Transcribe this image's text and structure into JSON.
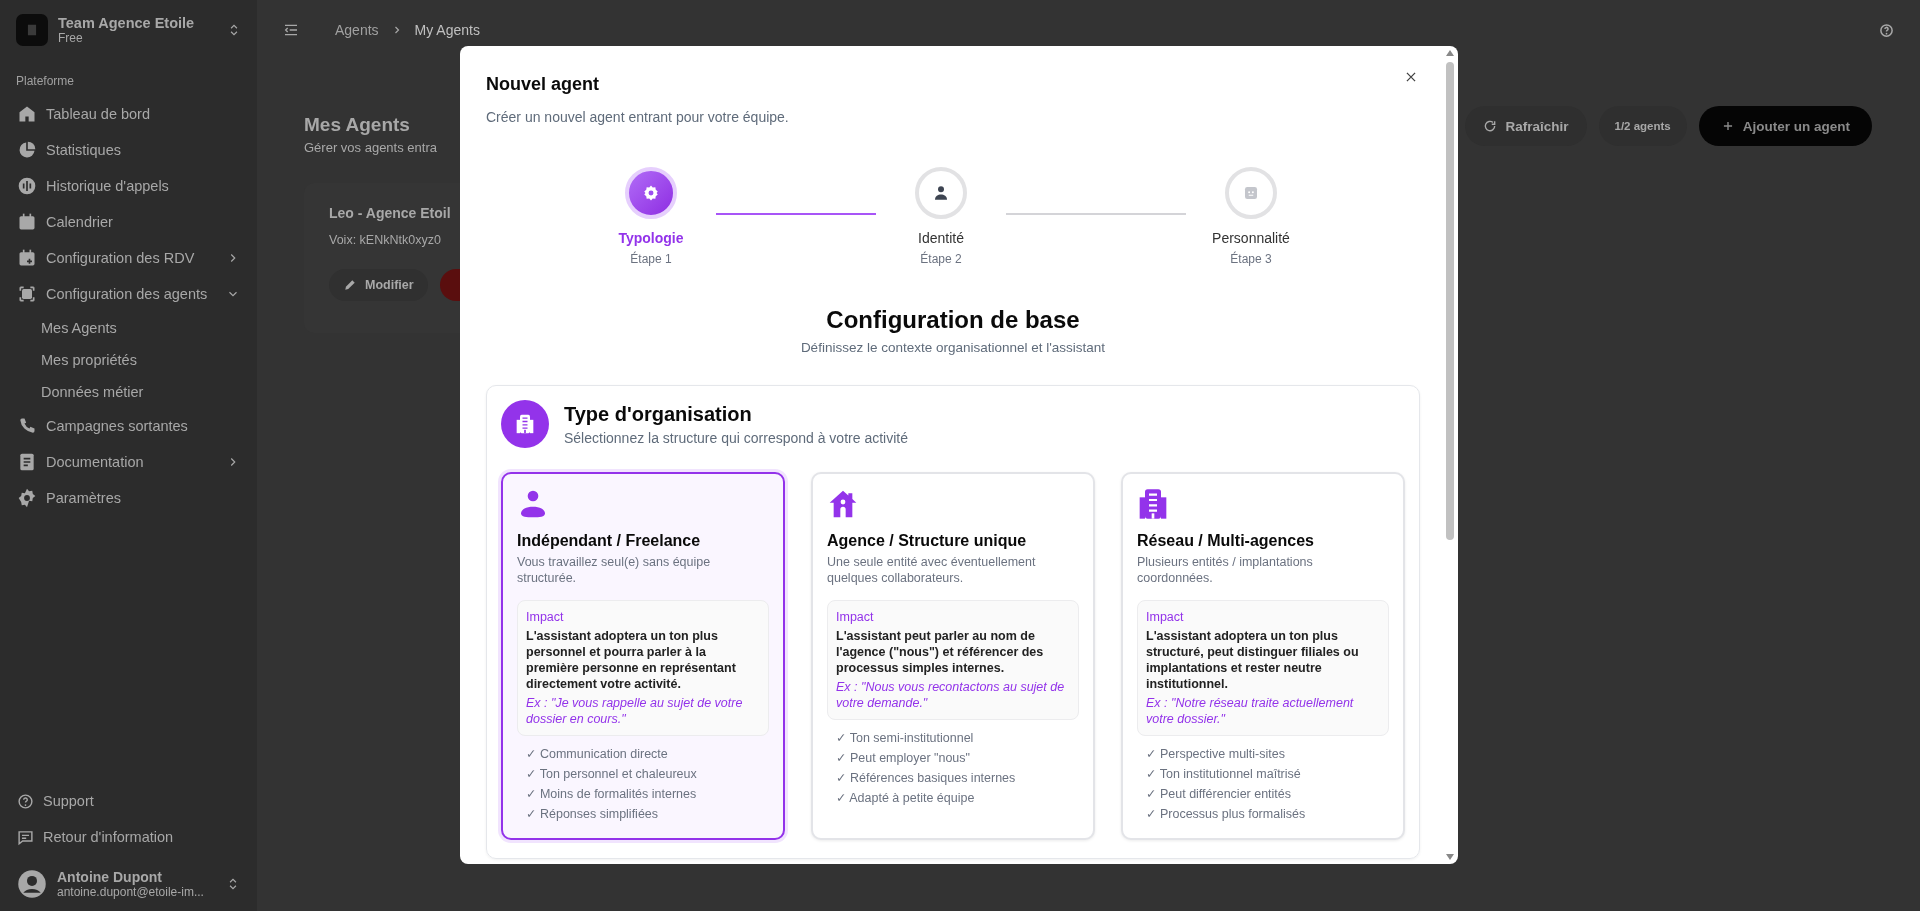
{
  "sidebar": {
    "team": {
      "name": "Team Agence Etoile",
      "plan": "Free"
    },
    "section_label": "Plateforme",
    "items": [
      {
        "label": "Tableau de bord"
      },
      {
        "label": "Statistiques"
      },
      {
        "label": "Historique d'appels"
      },
      {
        "label": "Calendrier"
      },
      {
        "label": "Configuration des RDV",
        "expanded": false
      },
      {
        "label": "Configuration des agents",
        "expanded": true,
        "children": [
          {
            "label": "Mes Agents"
          },
          {
            "label": "Mes propriétés"
          },
          {
            "label": "Données métier"
          }
        ]
      },
      {
        "label": "Campagnes sortantes"
      },
      {
        "label": "Documentation",
        "expanded": false
      },
      {
        "label": "Paramètres"
      }
    ],
    "footer_links": [
      "Support",
      "Retour d'information"
    ],
    "user": {
      "name": "Antoine Dupont",
      "email": "antoine.dupont@etoile-im..."
    }
  },
  "header": {
    "breadcrumb": [
      "Agents",
      "My Agents"
    ]
  },
  "page": {
    "title": "Mes Agents",
    "subtitle": "Gérer vos agents entra",
    "refresh_label": "Rafraîchir",
    "agent_count": "1/2 agents",
    "add_label": "Ajouter un agent",
    "agent": {
      "name": "Leo - Agence Etoil",
      "voice": "Voix: kENkNtk0xyz0",
      "edit_label": "Modifier"
    }
  },
  "modal": {
    "title": "Nouvel agent",
    "subtitle": "Créer un nouvel agent entrant pour votre équipe.",
    "steps": [
      {
        "label": "Typologie",
        "step": "Étape 1",
        "selected": true
      },
      {
        "label": "Identité",
        "step": "Étape 2",
        "selected": false
      },
      {
        "label": "Personnalité",
        "step": "Étape 3",
        "selected": false
      }
    ],
    "heading": "Configuration de base",
    "subheading": "Définissez le contexte organisationnel et l'assistant",
    "organization": {
      "title": "Type d'organisation",
      "subtitle": "Sélectionnez la structure qui correspond à votre activité",
      "options": [
        {
          "title": "Indépendant / Freelance",
          "description": "Vous travaillez seul(e) sans équipe structurée.",
          "impact_label": "Impact",
          "impact": "L'assistant adoptera un ton plus personnel et pourra parler à la première personne en représentant directement votre activité.",
          "example": "Ex : \"Je vous rappelle au sujet de votre dossier en cours.\"",
          "features": [
            "✓ Communication directe",
            "✓ Ton personnel et chaleureux",
            "✓ Moins de formalités internes",
            "✓ Réponses simplifiées"
          ],
          "selected": true
        },
        {
          "title": "Agence / Structure unique",
          "description": "Une seule entité avec éventuellement quelques collaborateurs.",
          "impact_label": "Impact",
          "impact": "L'assistant peut parler au nom de l'agence (\"nous\") et référencer des processus simples internes.",
          "example": "Ex : \"Nous vous recontactons au sujet de votre demande.\"",
          "features": [
            "✓ Ton semi-institutionnel",
            "✓ Peut employer \"nous\"",
            "✓ Références basiques internes",
            "✓ Adapté à petite équipe"
          ],
          "selected": false
        },
        {
          "title": "Réseau / Multi-agences",
          "description": "Plusieurs entités / implantations coordonnées.",
          "impact_label": "Impact",
          "impact": "L'assistant adoptera un ton plus structuré, peut distinguer filiales ou implantations et rester neutre institutionnel.",
          "example": "Ex : \"Notre réseau traite actuellement votre dossier.\"",
          "features": [
            "✓ Perspective multi-sites",
            "✓ Ton institutionnel maîtrisé",
            "✓ Peut différencier entités",
            "✓ Processus plus formalisés"
          ],
          "selected": false
        }
      ]
    }
  }
}
